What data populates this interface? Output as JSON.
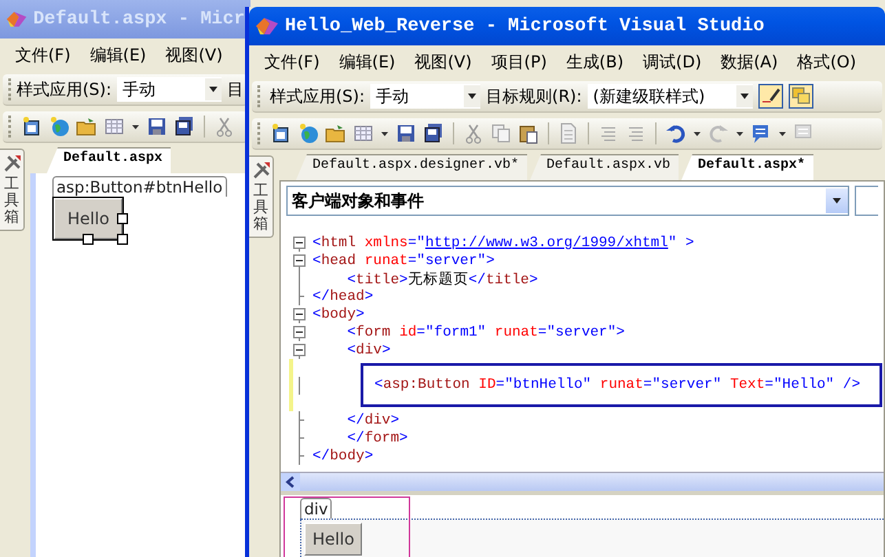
{
  "back_window": {
    "title": "Default.aspx - Micr",
    "active": false,
    "menu": [
      {
        "label": "文件(F)"
      },
      {
        "label": "编辑(E)"
      },
      {
        "label": "视图(V)"
      }
    ],
    "style_toolbar": {
      "label": "样式应用(S):",
      "value": "手动",
      "next_label": "目"
    },
    "toolbox": "工具箱",
    "tabs": [
      {
        "label": "Default.aspx",
        "selected": true
      }
    ],
    "designer": {
      "tag": "asp:Button#btnHello",
      "button": "Hello",
      "selected": true
    }
  },
  "front_window": {
    "title": "Hello_Web_Reverse - Microsoft Visual Studio",
    "active": true,
    "menu": [
      {
        "label": "文件(F)"
      },
      {
        "label": "编辑(E)"
      },
      {
        "label": "视图(V)"
      },
      {
        "label": "项目(P)"
      },
      {
        "label": "生成(B)"
      },
      {
        "label": "调试(D)"
      },
      {
        "label": "数据(A)"
      },
      {
        "label": "格式(O)"
      }
    ],
    "style_toolbar": {
      "label": "样式应用(S):",
      "value": "手动",
      "target_label": "目标规则(R):",
      "target_value": "(新建级联样式)"
    },
    "toolbox": "工具箱",
    "tabs": [
      {
        "label": "Default.aspx.designer.vb*",
        "selected": false
      },
      {
        "label": "Default.aspx.vb",
        "selected": false
      },
      {
        "label": "Default.aspx*",
        "selected": true
      }
    ],
    "object_dropdown": "客户端对象和事件",
    "code_lines": [
      {
        "text": "<html xmlns=\"http://www.w3.org/1999/xhtml\" >",
        "kind": "start",
        "changed": false,
        "boxed": false
      },
      {
        "text": "<head runat=\"server\">",
        "kind": "start",
        "changed": false,
        "boxed": false
      },
      {
        "text": "    <title>无标题页</title>",
        "kind": "line",
        "changed": false,
        "boxed": false
      },
      {
        "text": "</head>",
        "kind": "end",
        "changed": false,
        "boxed": false
      },
      {
        "text": "<body>",
        "kind": "start",
        "changed": false,
        "boxed": false
      },
      {
        "text": "    <form id=\"form1\" runat=\"server\">",
        "kind": "start",
        "changed": false,
        "boxed": false
      },
      {
        "text": "    <div>",
        "kind": "start",
        "changed": false,
        "boxed": false
      },
      {
        "text": "<asp:Button ID=\"btnHello\" runat=\"server\" Text=\"Hello\" />",
        "kind": "line",
        "changed": true,
        "boxed": true
      },
      {
        "text": "    </div>",
        "kind": "end",
        "changed": false,
        "boxed": false
      },
      {
        "text": "    </form>",
        "kind": "end",
        "changed": false,
        "boxed": false
      },
      {
        "text": "</body>",
        "kind": "end",
        "changed": false,
        "boxed": false
      }
    ],
    "design_view": {
      "tag": "div",
      "button": "Hello",
      "selected": true
    }
  }
}
